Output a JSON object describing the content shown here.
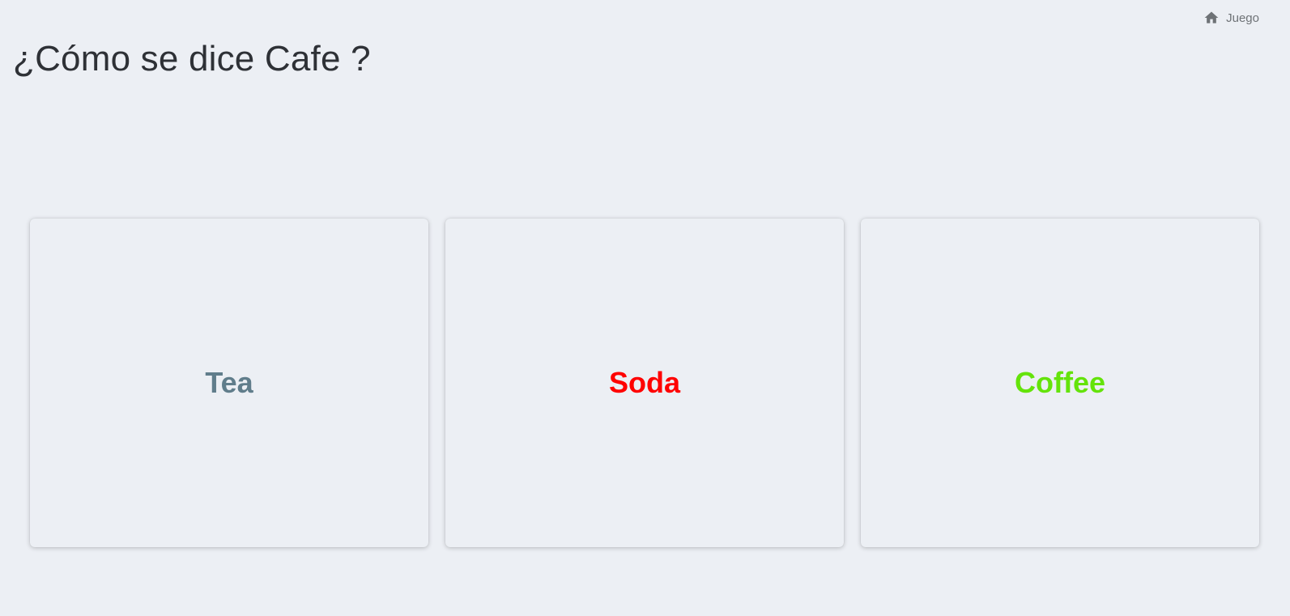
{
  "breadcrumb": {
    "icon": "home-icon",
    "label": "Juego"
  },
  "question": {
    "text": "¿Cómo se dice Cafe ?"
  },
  "options": [
    {
      "label": "Tea",
      "color": "#607d8b"
    },
    {
      "label": "Soda",
      "color": "#ff0000"
    },
    {
      "label": "Coffee",
      "color": "#64e30a"
    }
  ]
}
